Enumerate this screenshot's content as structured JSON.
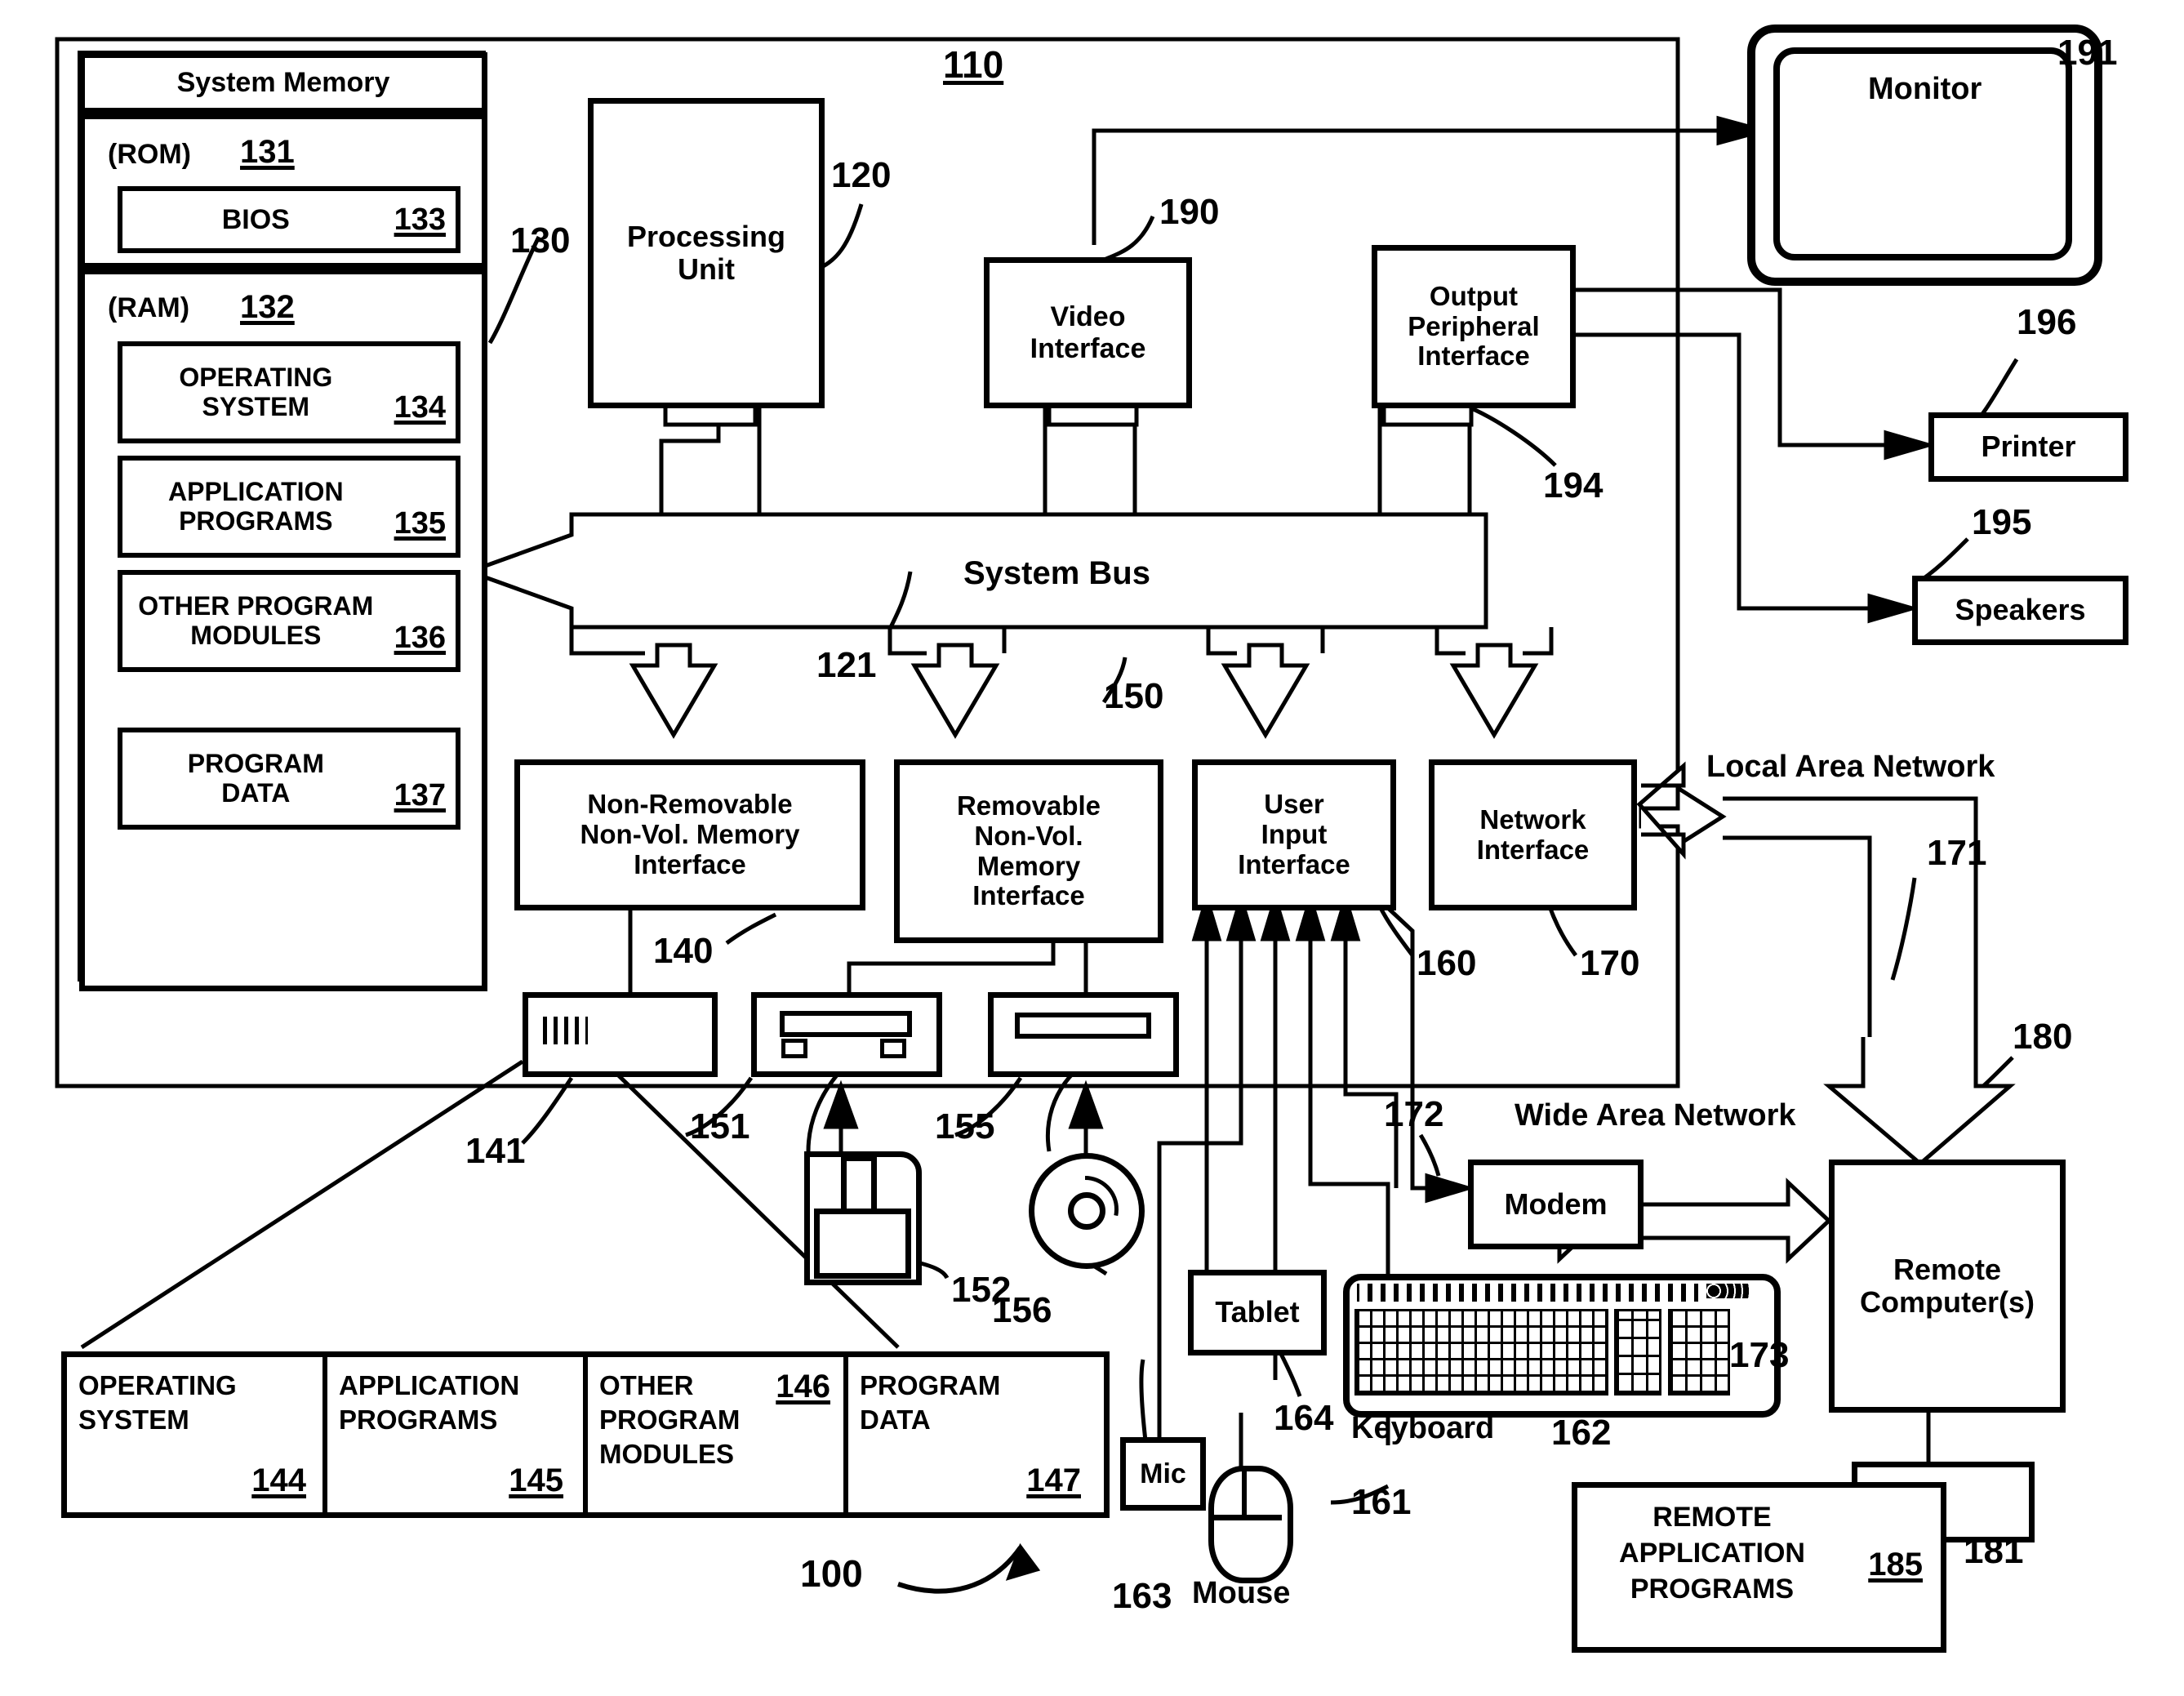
{
  "figure": {
    "ref_100": "100",
    "ref_110": "110"
  },
  "system_memory": {
    "title": "System Memory",
    "rom_label": "(ROM)",
    "rom_ref": "131",
    "bios_label": "BIOS",
    "bios_ref": "133",
    "ram_label": "(RAM)",
    "ram_ref": "132",
    "memory_ref": "130",
    "items": [
      {
        "l1": "OPERATING",
        "l2": "SYSTEM",
        "ref": "134"
      },
      {
        "l1": "APPLICATION",
        "l2": "PROGRAMS",
        "ref": "135"
      },
      {
        "l1": "OTHER PROGRAM",
        "l2": "MODULES",
        "ref": "136"
      },
      {
        "l1": "PROGRAM",
        "l2": "DATA",
        "ref": "137"
      }
    ]
  },
  "core": {
    "processing_unit": "Processing\nUnit",
    "processing_unit_ref": "120",
    "video_interface": "Video\nInterface",
    "video_interface_ref": "190",
    "output_peripheral_interface": "Output\nPeripheral\nInterface",
    "output_peripheral_interface_ref": "194",
    "system_bus": "System Bus",
    "system_bus_ref": "121"
  },
  "interfaces": [
    {
      "text": "Non-Removable\nNon-Vol. Memory\nInterface",
      "ref": "140"
    },
    {
      "text": "Removable\nNon-Vol.\nMemory\nInterface",
      "ref": "150"
    },
    {
      "text": "User\nInput\nInterface",
      "ref": "160"
    },
    {
      "text": "Network\nInterface",
      "ref": "170"
    }
  ],
  "output_devices": {
    "monitor": "Monitor",
    "monitor_ref": "191",
    "printer": "Printer",
    "printer_ref": "196",
    "speakers": "Speakers",
    "speakers_ref": "195"
  },
  "storage": {
    "hard_drive_ref": "141",
    "floppy_drive_ref": "151",
    "floppy_disk_ref": "152",
    "optical_drive_ref": "155",
    "optical_disc_ref": "156"
  },
  "networks": {
    "lan_label": "Local Area Network",
    "lan_ref": "171",
    "wan_label": "Wide Area Network",
    "wan_ref": "173",
    "modem": "Modem",
    "modem_ref": "172",
    "remote_computer": "Remote\nComputer(s)",
    "remote_computer_ref": "180",
    "remote_drive_ref": "181",
    "remote_apps_l1": "REMOTE",
    "remote_apps_l2": "APPLICATION",
    "remote_apps_l3": "PROGRAMS",
    "remote_apps_ref": "185"
  },
  "input_devices": {
    "tablet": "Tablet",
    "tablet_ref": "164",
    "keyboard": "Keyboard",
    "keyboard_ref": "162",
    "mouse": "Mouse",
    "mouse_ref": "161",
    "mic": "Mic",
    "mic_ref": "163"
  },
  "hdd_contents": {
    "cells": [
      {
        "l1": "OPERATING",
        "l2": "SYSTEM",
        "ref": "144",
        "ref_pos": "bottom"
      },
      {
        "l1": "APPLICATION",
        "l2": "PROGRAMS",
        "ref": "145",
        "ref_pos": "bottom"
      },
      {
        "l1": "OTHER",
        "l2": "PROGRAM",
        "l3": "MODULES",
        "ref": "146",
        "ref_pos": "top"
      },
      {
        "l1": "PROGRAM",
        "l2": "DATA",
        "ref": "147",
        "ref_pos": "bottom"
      }
    ]
  }
}
